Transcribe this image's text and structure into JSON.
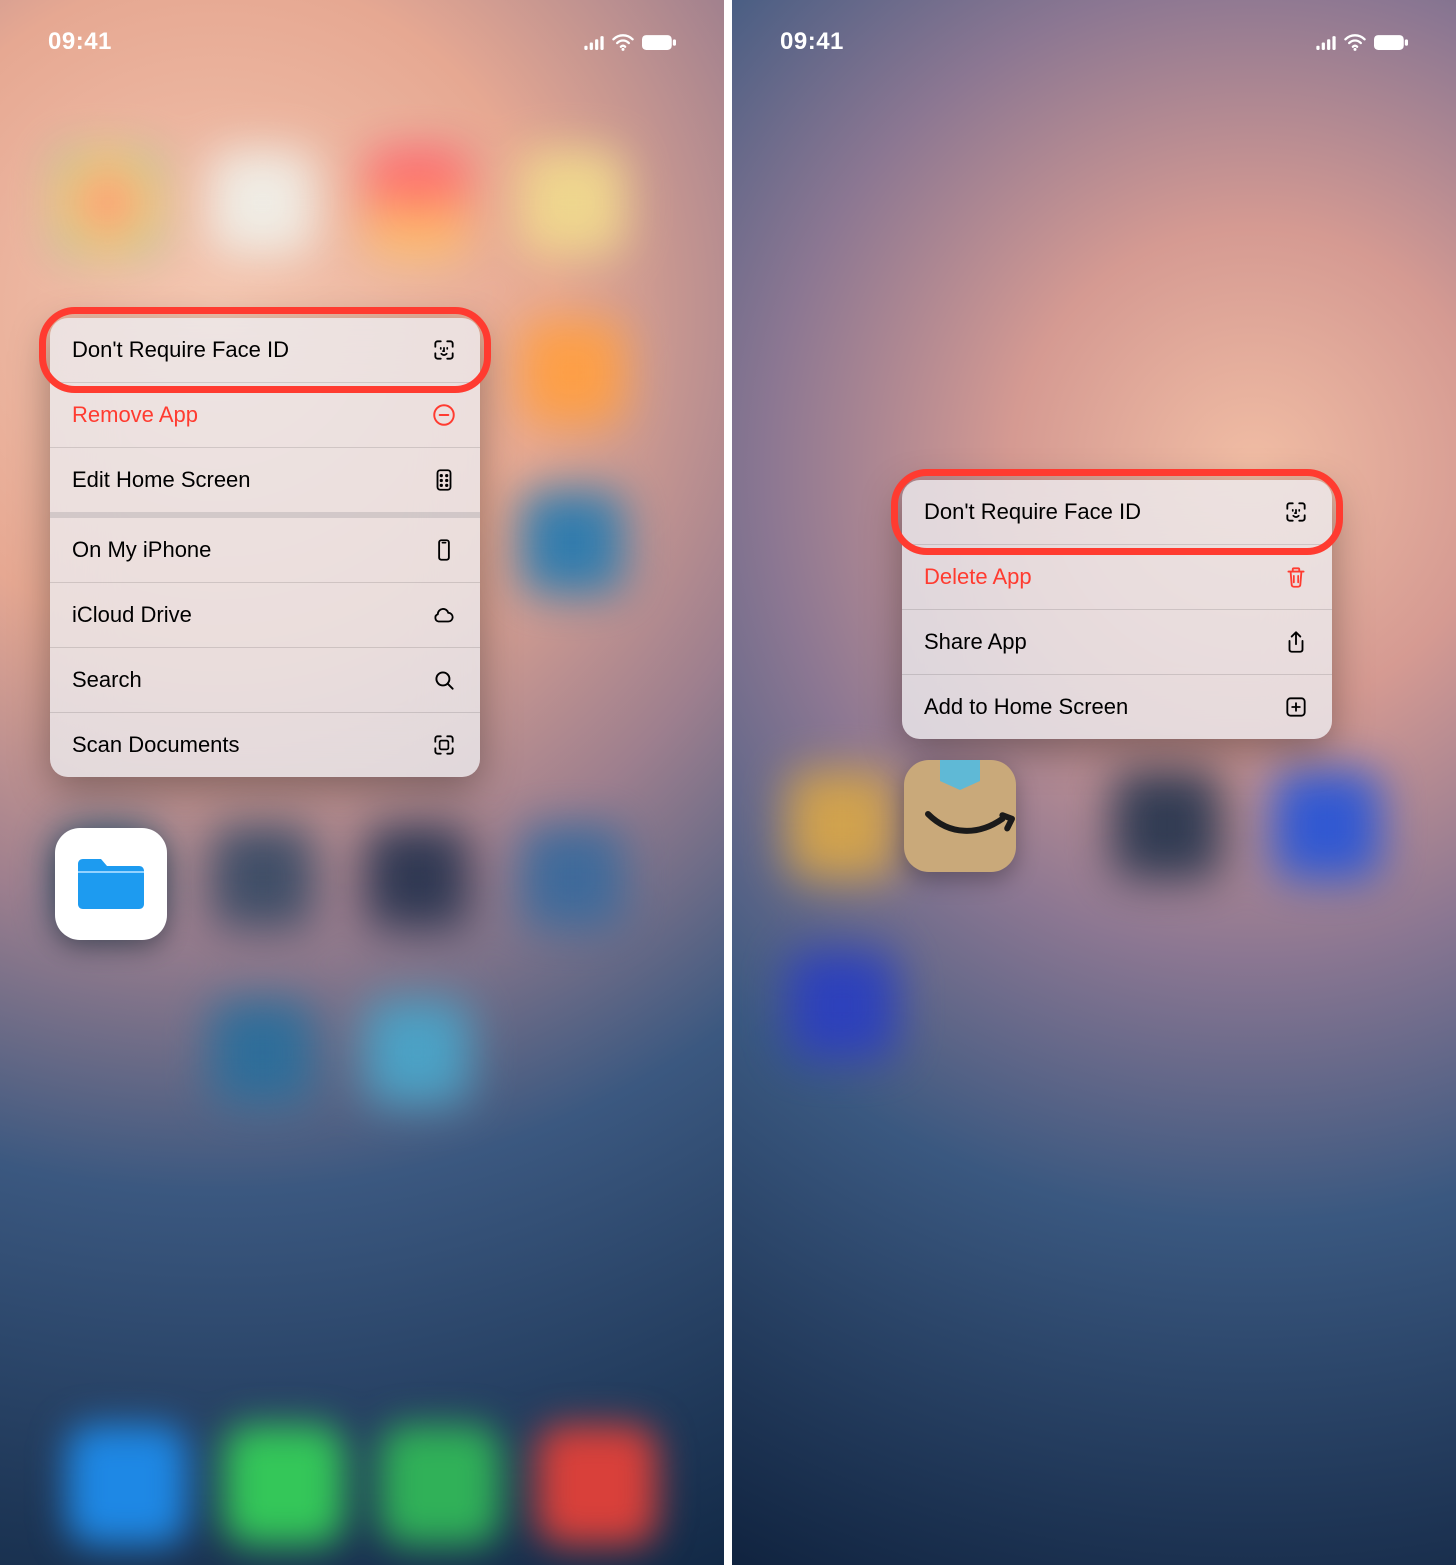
{
  "left": {
    "status": {
      "time": "09:41"
    },
    "menu": {
      "items": [
        {
          "label": "Don't Require Face ID",
          "icon": "faceid",
          "destructive": false,
          "highlight": true,
          "breakafter": false
        },
        {
          "label": "Remove App",
          "icon": "remove-circle",
          "destructive": true,
          "highlight": false,
          "breakafter": false
        },
        {
          "label": "Edit Home Screen",
          "icon": "apps",
          "destructive": false,
          "highlight": false,
          "breakafter": true
        },
        {
          "label": "On My iPhone",
          "icon": "iphone",
          "destructive": false,
          "highlight": false,
          "breakafter": false
        },
        {
          "label": "iCloud Drive",
          "icon": "cloud",
          "destructive": false,
          "highlight": false,
          "breakafter": false
        },
        {
          "label": "Search",
          "icon": "search",
          "destructive": false,
          "highlight": false,
          "breakafter": false
        },
        {
          "label": "Scan Documents",
          "icon": "scan",
          "destructive": false,
          "highlight": false,
          "breakafter": false
        }
      ]
    },
    "app": {
      "name": "Files"
    }
  },
  "right": {
    "status": {
      "time": "09:41"
    },
    "menu": {
      "items": [
        {
          "label": "Don't Require Face ID",
          "icon": "faceid",
          "destructive": false,
          "highlight": true,
          "breakafter": false
        },
        {
          "label": "Delete App",
          "icon": "trash",
          "destructive": true,
          "highlight": false,
          "breakafter": false
        },
        {
          "label": "Share App",
          "icon": "share",
          "destructive": false,
          "highlight": false,
          "breakafter": false
        },
        {
          "label": "Add to Home Screen",
          "icon": "add-square",
          "destructive": false,
          "highlight": false,
          "breakafter": false
        }
      ]
    },
    "app": {
      "name": "Amazon"
    }
  },
  "colors": {
    "highlight": "#ff3b30",
    "destructive": "#ff3b30"
  }
}
